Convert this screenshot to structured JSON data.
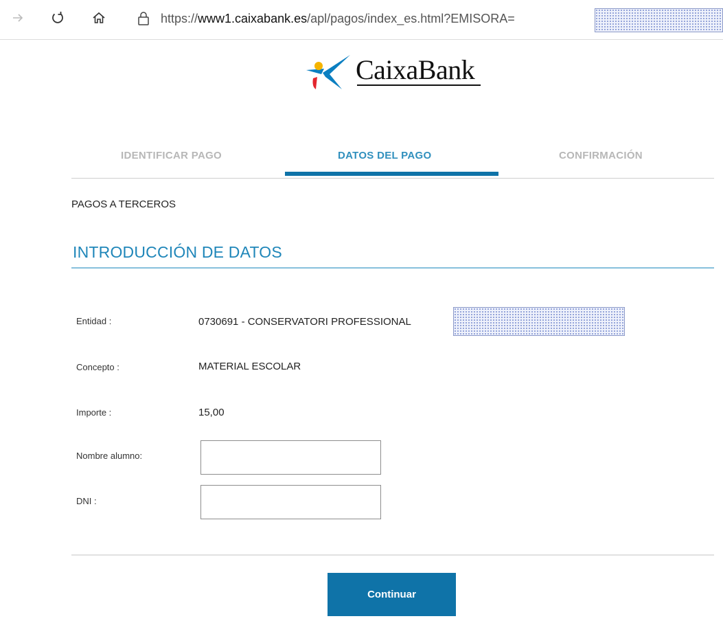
{
  "browser": {
    "url_prefix": "https://",
    "url_host": "www1.caixabank.es",
    "url_path": "/apl/pagos/index_es.html?EMISORA=",
    "forward_icon": "arrow-right-icon",
    "refresh_icon": "refresh-icon",
    "home_icon": "home-icon",
    "lock_icon": "lock-icon"
  },
  "logo": {
    "text": "CaixaBank"
  },
  "steps": [
    {
      "label": "IDENTIFICAR PAGO",
      "state": "inactive"
    },
    {
      "label": "DATOS DEL PAGO",
      "state": "active"
    },
    {
      "label": "CONFIRMACIÓN",
      "state": "inactive"
    }
  ],
  "section": {
    "kicker": "PAGOS A TERCEROS",
    "title": "INTRODUCCIÓN DE DATOS"
  },
  "fields": {
    "entidad": {
      "label": "Entidad :",
      "value": "0730691 - CONSERVATORI PROFESSIONAL"
    },
    "concepto": {
      "label": "Concepto :",
      "value": "MATERIAL ESCOLAR"
    },
    "importe": {
      "label": "Importe :",
      "value": "15,00"
    },
    "nombre": {
      "label": "Nombre alumno:",
      "value": ""
    },
    "dni": {
      "label": "DNI :",
      "value": ""
    }
  },
  "actions": {
    "continue_label": "Continuar"
  },
  "colors": {
    "accent": "#0f73a8",
    "title_blue": "#1f86b9",
    "inactive_step": "#b7b7b7"
  }
}
